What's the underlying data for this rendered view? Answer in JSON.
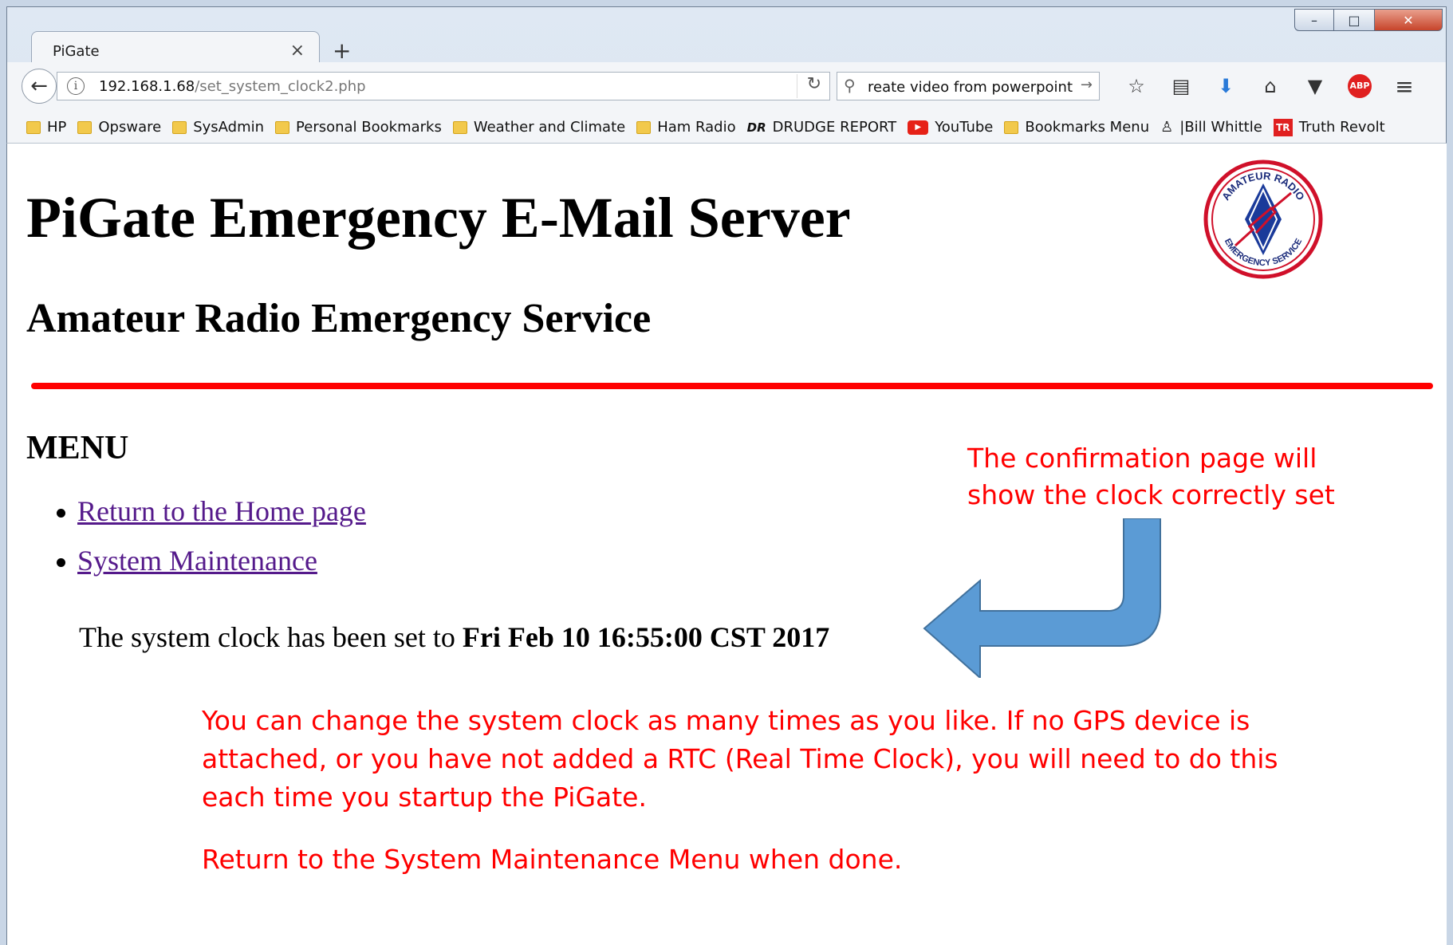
{
  "browser": {
    "tab_title": "PiGate",
    "tab_close": "×",
    "new_tab": "+",
    "url_host": "192.168.1.68",
    "url_path": "/set_system_clock2.php",
    "search_text": "reate video from powerpoint",
    "icons": [
      "back-icon",
      "info-icon",
      "reload-icon",
      "search-icon",
      "star-icon",
      "reading-list-icon",
      "download-icon",
      "home-icon",
      "pocket-icon",
      "adblock-icon",
      "menu-icon"
    ],
    "window_controls": {
      "minimize": "–",
      "maximize": "□",
      "close": "✕"
    }
  },
  "bookmarks": [
    {
      "label": "HP",
      "icon": "folder-icon"
    },
    {
      "label": "Opsware",
      "icon": "folder-icon"
    },
    {
      "label": "SysAdmin",
      "icon": "folder-icon"
    },
    {
      "label": "Personal Bookmarks",
      "icon": "folder-icon"
    },
    {
      "label": "Weather and Climate",
      "icon": "folder-icon"
    },
    {
      "label": "Ham Radio",
      "icon": "folder-icon"
    },
    {
      "label": "DRUDGE REPORT",
      "icon": "drudge-icon"
    },
    {
      "label": "YouTube",
      "icon": "youtube-icon"
    },
    {
      "label": "Bookmarks Menu",
      "icon": "folder-icon"
    },
    {
      "label": "|Bill Whittle",
      "icon": "bill-whittle-icon"
    },
    {
      "label": "Truth Revolt",
      "icon": "truth-revolt-icon"
    }
  ],
  "page": {
    "title": "PiGate Emergency E-Mail Server",
    "subtitle": "Amateur Radio Emergency Service",
    "menu_heading": "MENU",
    "menu_items": [
      "Return to the Home page",
      "System Maintenance"
    ],
    "clock_prefix": "The system clock has been set to ",
    "clock_value": "Fri Feb 10 16:55:00 CST 2017",
    "logo_text_top": "AMATEUR RADIO",
    "logo_text_bottom": "EMERGENCY SERVICE",
    "logo_center": "ARES",
    "divider_color": "#ff0000"
  },
  "annotations": {
    "confirmation_line1": "The confirmation page will",
    "confirmation_line2": "show the clock correctly set",
    "info_line1": "You can change the system clock as many times as you like.  If no GPS device is",
    "info_line2": "attached, or you have not added a RTC (Real Time Clock), you will need to do this",
    "info_line3": "each time you startup the PiGate.",
    "return_note": "Return to the System Maintenance  Menu when done.",
    "text_color": "#ff0000",
    "arrow_color": "#5b9bd5"
  }
}
